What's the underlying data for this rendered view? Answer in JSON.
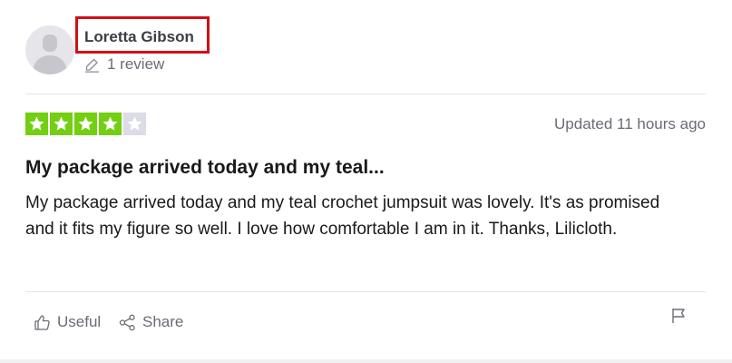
{
  "reviewer": {
    "name": "Loretta Gibson",
    "review_count": "1 review",
    "avatar_icon": "avatar-placeholder-icon",
    "review_icon": "pencil-icon"
  },
  "review": {
    "rating": 4,
    "max_rating": 5,
    "star_color": "#73cf11",
    "updated": "Updated 11 hours ago",
    "title": "My package arrived today and my teal...",
    "body": "My package arrived today and my teal crochet jumpsuit was lovely. It's as promised and it fits my figure so well. I love how comfortable I am in it. Thanks, Lilicloth."
  },
  "actions": {
    "useful_label": "Useful",
    "share_label": "Share",
    "useful_icon": "thumbs-up-icon",
    "share_icon": "share-icon",
    "report_icon": "flag-icon"
  },
  "highlight_color": "#d20e16"
}
